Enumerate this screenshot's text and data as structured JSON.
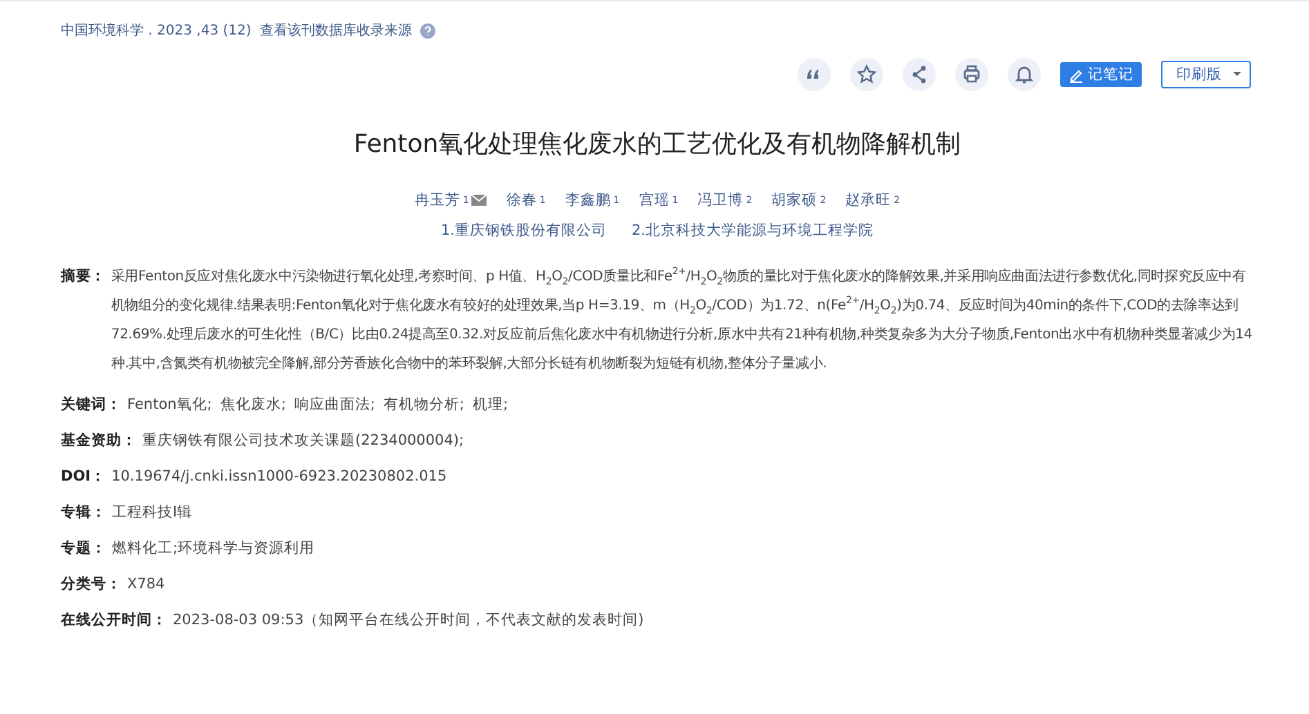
{
  "source": {
    "journal": "中国环境科学 . 2023 ,43 (12)",
    "link": "查看该刊数据库收录来源"
  },
  "toolbar": {
    "icons": [
      {
        "kind": "quote"
      },
      {
        "kind": "star"
      },
      {
        "kind": "share"
      },
      {
        "kind": "print"
      },
      {
        "kind": "bell"
      }
    ],
    "note_button": "记笔记",
    "print_menu": "印刷版"
  },
  "title": "Fenton氧化处理焦化废水的工艺优化及有机物降解机制",
  "authors": [
    {
      "name": "冉玉芳",
      "affiliation": "1",
      "mail": true
    },
    {
      "name": "徐春",
      "affiliation": "1",
      "mail": false
    },
    {
      "name": "李鑫鹏",
      "affiliation": "1",
      "mail": false
    },
    {
      "name": "宫瑶",
      "affiliation": "1",
      "mail": false
    },
    {
      "name": "冯卫博",
      "affiliation": "2",
      "mail": false
    },
    {
      "name": "胡家硕",
      "affiliation": "2",
      "mail": false
    },
    {
      "name": "赵承旺",
      "affiliation": "2",
      "mail": false
    }
  ],
  "affiliations": [
    "1.重庆钢铁股份有限公司",
    "2.北京科技大学能源与环境工程学院"
  ],
  "abstract": {
    "label": "摘要：",
    "text": "采用Fenton反应对焦化废水中污染物进行氧化处理,考察时间、p H值、H$_{2}$O$_{2}$/COD质量比和Fe$^{2+}$/H$_{2}$O$_{2}$物质的量比对于焦化废水的降解效果,并采用响应曲面法进行参数优化,同时探究反应中有机物组分的变化规律.结果表明:Fenton氧化对于焦化废水有较好的处理效果,当p H=3.19、m（H$_{2}$O$_{2}$/COD）为1.72、n(Fe$^{2+}$/H$_{2}$O$_{2}$)为0.74、反应时间为40min的条件下,COD的去除率达到72.69%.处理后废水的可生化性（B/C）比由0.24提高至0.32.对反应前后焦化废水中有机物进行分析,原水中共有21种有机物,种类复杂多为大分子物质,Fenton出水中有机物种类显著减少为14种.其中,含氮类有机物被完全降解,部分芳香族化合物中的苯环裂解,大部分长链有机物断裂为短链有机物,整体分子量减小."
  },
  "fields": [
    {
      "label": "关键词：",
      "kind": "links",
      "items": [
        "Fenton氧化;",
        "焦化废水;",
        "响应曲面法;",
        "有机物分析;",
        "机理;"
      ]
    },
    {
      "label": "基金资助：",
      "kind": "links",
      "items": [
        "重庆钢铁有限公司技术攻关课题(2234000004);"
      ]
    },
    {
      "label": "DOI：",
      "kind": "text",
      "value": "10.19674/j.cnki.issn1000-6923.20230802.015"
    },
    {
      "label": "专辑：",
      "kind": "text",
      "value": "工程科技Ⅰ辑"
    },
    {
      "label": "专题：",
      "kind": "text",
      "value": "燃料化工;环境科学与资源利用"
    },
    {
      "label": "分类号：",
      "kind": "text",
      "value": "X784"
    },
    {
      "label": "在线公开时间：",
      "kind": "text",
      "value": "2023-08-03 09:53（知网平台在线公开时间，不代表文献的发表时间)"
    }
  ]
}
